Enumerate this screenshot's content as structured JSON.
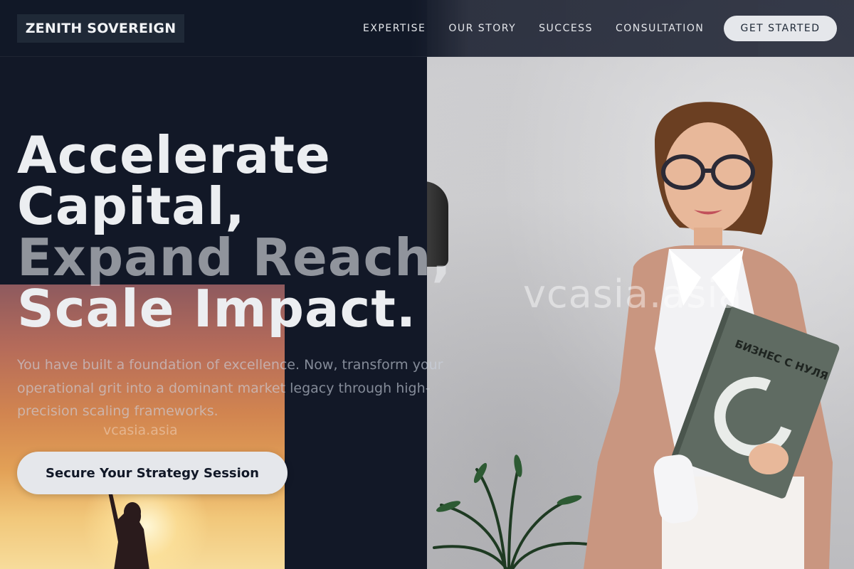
{
  "brand": {
    "name": "ZENITH SOVEREIGN"
  },
  "nav": {
    "links": [
      "EXPERTISE",
      "OUR STORY",
      "SUCCESS",
      "CONSULTATION"
    ],
    "cta_label": "GET STARTED"
  },
  "hero": {
    "title_lines": [
      "Accelerate",
      "Capital,",
      "Expand Reach,",
      "Scale Impact."
    ],
    "subtitle": "You have built a foundation of excellence. Now, transform your operational grit into a dominant market legacy through high-precision scaling frameworks.",
    "button_label": "Secure Your Strategy Session"
  },
  "images": {
    "left_watermark": "vcasia.asia",
    "right_watermark": "vcasia.asia",
    "book_title": "БИЗНЕС С НУЛЯ"
  },
  "colors": {
    "background": "#121827",
    "nav_bg": "#111827",
    "logo_bg": "#1f2937",
    "button_bg": "#e5e7eb",
    "button_text": "#111827",
    "heading_text": "#eceef1"
  }
}
